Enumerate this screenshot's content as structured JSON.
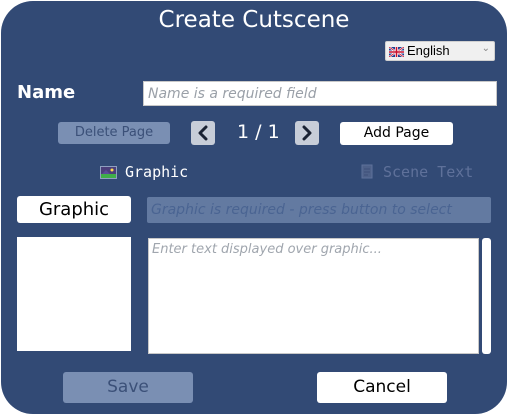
{
  "dialog": {
    "title": "Create Cutscene"
  },
  "language": {
    "selected": "English",
    "flag_icon": "uk-flag-icon",
    "dropdown_icon": "chevron-down-icon"
  },
  "name": {
    "label": "Name",
    "value": "",
    "placeholder": "Name is a required field"
  },
  "pagination": {
    "delete_label": "Delete Page",
    "prev_icon": "chevron-left-icon",
    "counter": "1 / 1",
    "next_icon": "chevron-right-icon",
    "add_label": "Add Page"
  },
  "toggles": {
    "graphic": {
      "label": "Graphic",
      "icon": "image-icon",
      "enabled": true
    },
    "scene_text": {
      "label": "Scene Text",
      "icon": "document-icon",
      "enabled": false
    }
  },
  "graphic": {
    "button_label": "Graphic",
    "field_text": "Graphic is required - press button to select"
  },
  "text": {
    "value": "",
    "placeholder": "Enter text displayed over graphic..."
  },
  "footer": {
    "save_label": "Save",
    "cancel_label": "Cancel"
  },
  "colors": {
    "dialog_bg": "#324a75",
    "disabled_button": "#7a8fb3",
    "disabled_field": "#637aa1",
    "text_light": "#ffffff"
  }
}
